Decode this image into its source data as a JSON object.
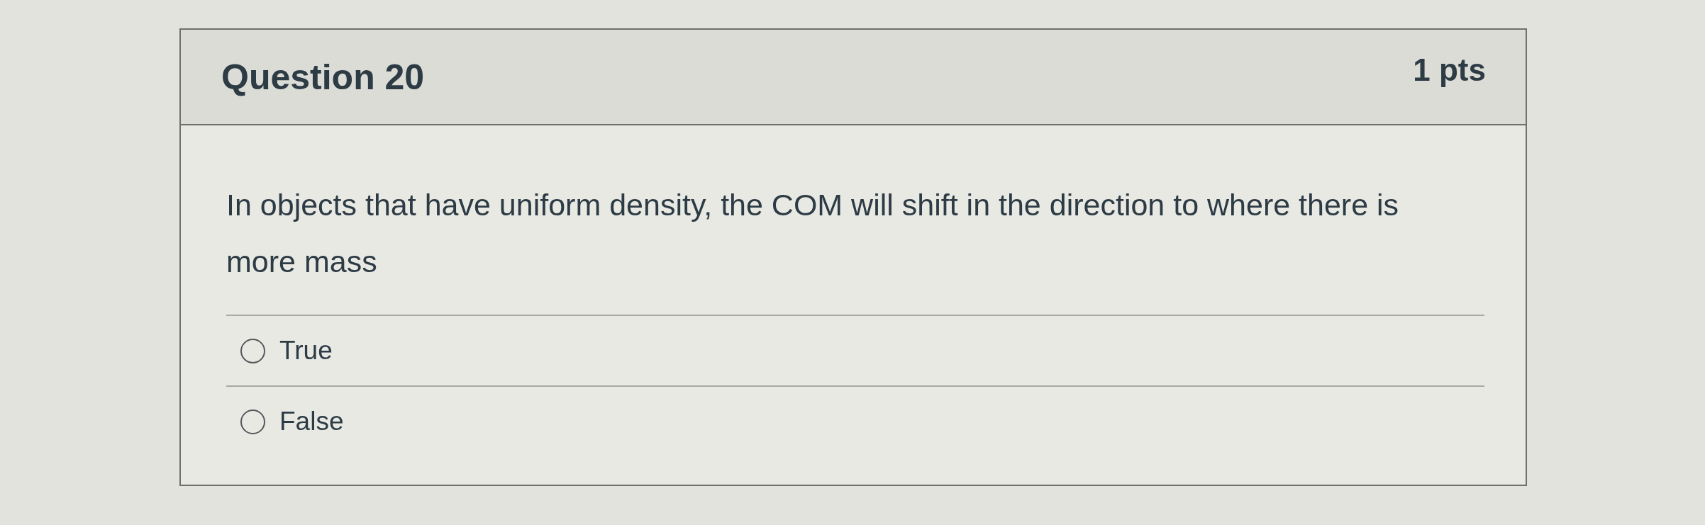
{
  "question": {
    "title": "Question 20",
    "points": "1 pts",
    "text": "In objects that have uniform density, the COM will shift in the direction to where there is more mass",
    "answers": [
      {
        "label": "True",
        "selected": false
      },
      {
        "label": "False",
        "selected": false
      }
    ]
  }
}
